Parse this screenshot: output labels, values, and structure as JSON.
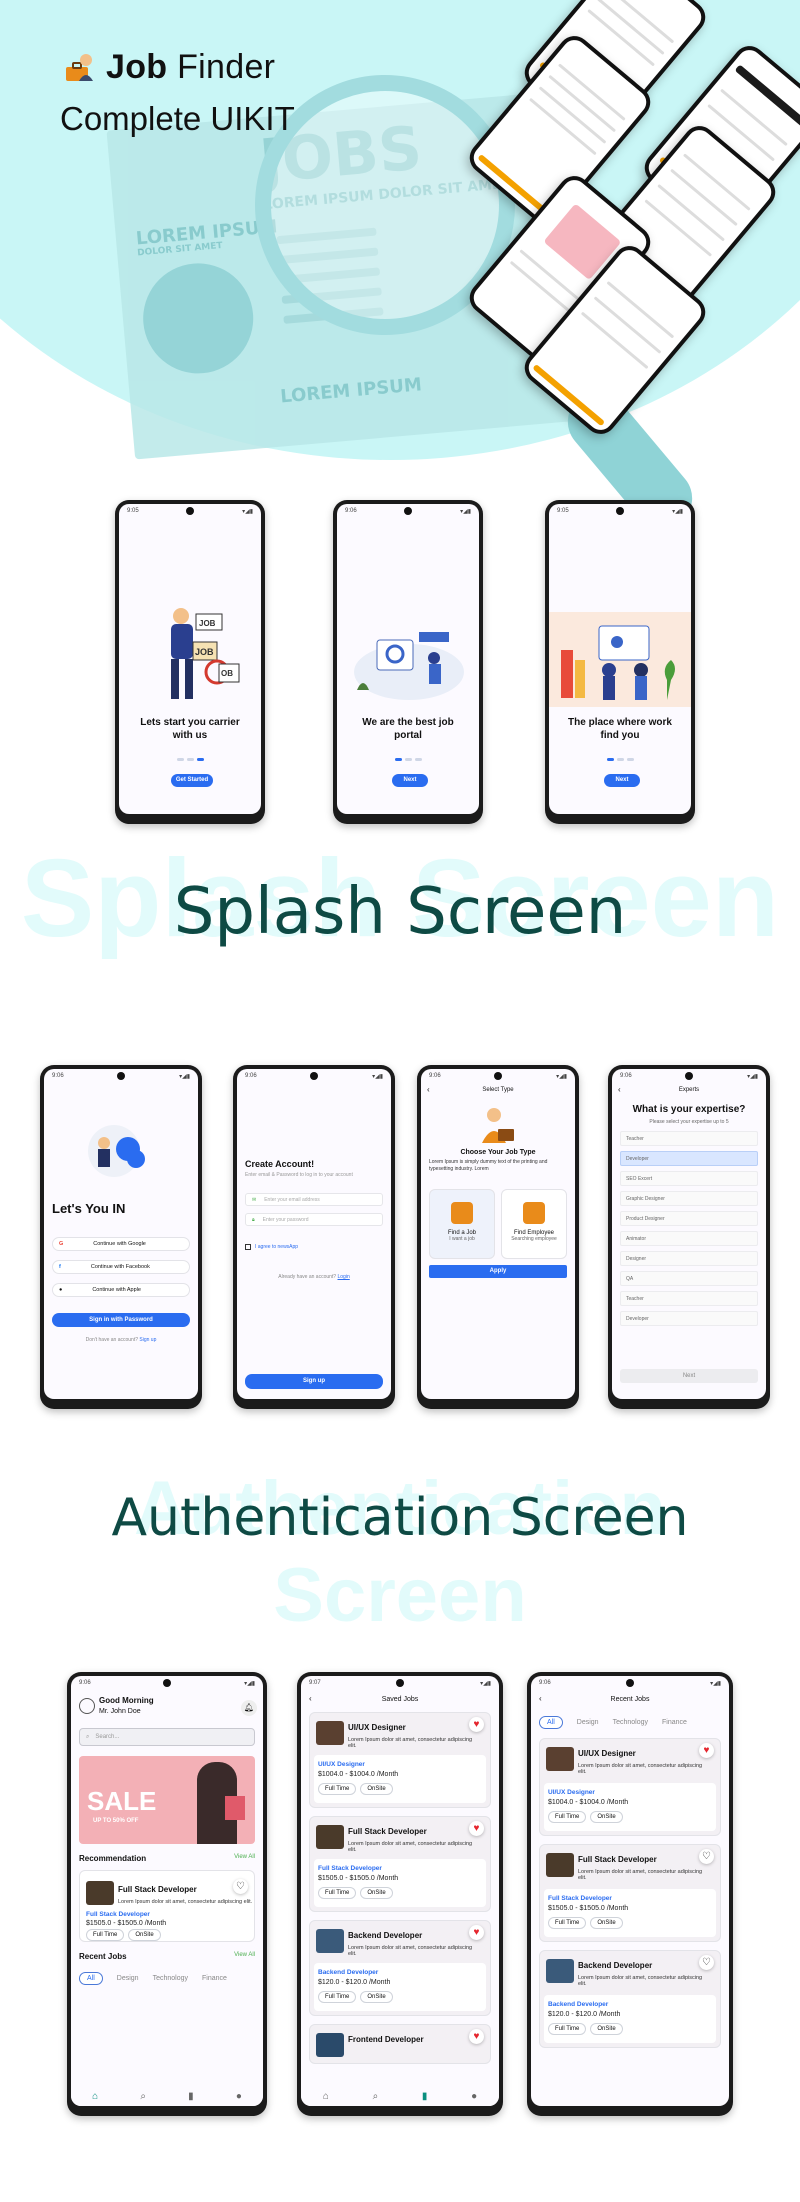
{
  "hero": {
    "title_bold": "Job",
    "title_rest": " Finder",
    "subtitle": "Complete UIKIT",
    "newspaper_headline": "JOBS",
    "newspaper_sub": "LOREM IPSUM DOLOR SIT AMET",
    "lorem1": "LOREM IPSUM",
    "lorem1_sub": "DOLOR SIT AMET",
    "lorem2": "LOREM IPSUM"
  },
  "splash": {
    "ghost": "Splash Screen",
    "title": "Splash Screen",
    "screens": [
      {
        "time": "9:05",
        "title": "Lets start you carrier with us",
        "button": "Get Started"
      },
      {
        "time": "9:06",
        "title": "We are the best job portal",
        "button": "Next"
      },
      {
        "time": "9:05",
        "title": "The place where work find you",
        "button": "Next"
      }
    ]
  },
  "auth": {
    "ghost": "Authentication Screen",
    "title": "Authentication Screen",
    "login": {
      "time": "9:06",
      "heading": "Let's You IN",
      "google": "Continue with Google",
      "facebook": "Continue with Facebook",
      "apple": "Continue with Apple",
      "password_btn": "Sign in with Password",
      "footer": "Don't have an account?",
      "footer_link": "Sign up"
    },
    "create": {
      "time": "9:06",
      "heading": "Create Account!",
      "sub": "Enter email & Password to log in to your account",
      "email_ph": "Enter your email address",
      "pass_ph": "Enter your password",
      "agree": "I agree to newsApp",
      "footer": "Already have an account?",
      "footer_link": "Login",
      "button": "Sign up"
    },
    "type": {
      "time": "9:06",
      "header": "Select Type",
      "heading": "Choose Your Job Type",
      "desc": "Lorem Ipsum is simply dummy text of the printing and typesetting industry. Lorem",
      "opt1_title": "Find a Job",
      "opt1_sub": "I want a job",
      "opt2_title": "Find Employee",
      "opt2_sub": "Searching employee",
      "button": "Apply"
    },
    "experts": {
      "time": "9:06",
      "header": "Experts",
      "heading": "What is your expertise?",
      "sub": "Please select your expertise up to 5",
      "items": [
        "Teacher",
        "Developer",
        "SEO Excert",
        "Graphic Designer",
        "Product Designer",
        "Animator",
        "Designer",
        "QA",
        "Teacher",
        "Developer"
      ],
      "button": "Next"
    }
  },
  "jobs": {
    "home": {
      "time": "9:06",
      "greeting": "Good Morning",
      "name": "Mr. John Doe",
      "search_ph": "Search...",
      "banner": "SALE",
      "banner_sub": "UP TO 50% OFF",
      "recommendation": "Recommendation",
      "view_all": "View All",
      "card_title": "Full Stack Developer",
      "card_sub": "Lorem Ipsum dolor sit amet, consectetur adipiscing elit.",
      "card_role": "Full Stack Developer",
      "card_salary": "$1505.0 - $1505.0 /Month",
      "chip1": "Full Time",
      "chip2": "OnSite",
      "recent": "Recent Jobs",
      "recent_view_all": "View All",
      "tabs": [
        "All",
        "Design",
        "Technology",
        "Finance"
      ]
    },
    "saved": {
      "time": "9:07",
      "header": "Saved Jobs",
      "items": [
        {
          "title": "UI/UX Designer",
          "sub": "Lorem Ipsum dolor sit amet, consectetur adipiscing elit.",
          "role": "UI/UX Designer",
          "salary": "$1004.0 - $1004.0 /Month",
          "chip1": "Full Time",
          "chip2": "OnSite"
        },
        {
          "title": "Full Stack Developer",
          "sub": "Lorem Ipsum dolor sit amet, consectetur adipiscing elit.",
          "role": "Full Stack Developer",
          "salary": "$1505.0 - $1505.0 /Month",
          "chip1": "Full Time",
          "chip2": "OnSite"
        },
        {
          "title": "Backend Developer",
          "sub": "Lorem Ipsum dolor sit amet, consectetur adipiscing elit.",
          "role": "Backend Developer",
          "salary": "$120.0 - $120.0 /Month",
          "chip1": "Full Time",
          "chip2": "OnSite"
        },
        {
          "title": "Frontend Developer"
        }
      ]
    },
    "recent": {
      "time": "9:06",
      "header": "Recent Jobs",
      "tabs": [
        "All",
        "Design",
        "Technology",
        "Finance"
      ],
      "items": [
        {
          "title": "UI/UX Designer",
          "sub": "Lorem Ipsum dolor sit amet, consectetur adipiscing elit.",
          "role": "UI/UX Designer",
          "salary": "$1004.0 - $1004.0 /Month",
          "chip1": "Full Time",
          "chip2": "OnSite"
        },
        {
          "title": "Full Stack Developer",
          "sub": "Lorem Ipsum dolor sit amet, consectetur adipiscing elit.",
          "role": "Full Stack Developer",
          "salary": "$1505.0 - $1505.0 /Month",
          "chip1": "Full Time",
          "chip2": "OnSite"
        },
        {
          "title": "Backend Developer",
          "sub": "Lorem Ipsum dolor sit amet, consectetur adipiscing elit.",
          "role": "Backend Developer",
          "salary": "$120.0 - $120.0 /Month",
          "chip1": "Full Time",
          "chip2": "OnSite"
        }
      ]
    }
  },
  "colors": {
    "accent": "#2a6cf0",
    "heading": "#0e4a44",
    "ghost": "#e2fbfb",
    "hero_bg": "#c9f6f6",
    "heart": "#e5262e",
    "orange": "#f4a100"
  }
}
